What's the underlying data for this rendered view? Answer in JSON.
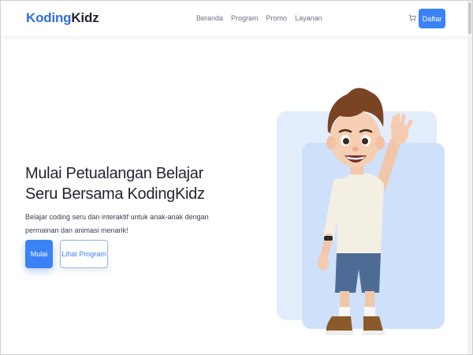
{
  "brand": {
    "part1": "Koding",
    "part2": "Kidz"
  },
  "nav": {
    "items": [
      "Beranda",
      "Program",
      "Promo",
      "Layanan"
    ]
  },
  "header": {
    "cart_icon": "cart-icon",
    "register_label": "Daftar"
  },
  "hero": {
    "title": "Mulai Petualangan Belajar Seru Bersama KodingKidz",
    "subtitle": "Belajar coding seru dan interaktif untuk anak-anak dengan permainan dan animasi menarik!",
    "primary_label": "Mulai",
    "secondary_label": "Lihat Program"
  },
  "colors": {
    "accent": "#3b82f6",
    "brand_blue": "#2f6fe0",
    "card_back": "#e4edfc",
    "card_front": "#cfe0fb"
  }
}
